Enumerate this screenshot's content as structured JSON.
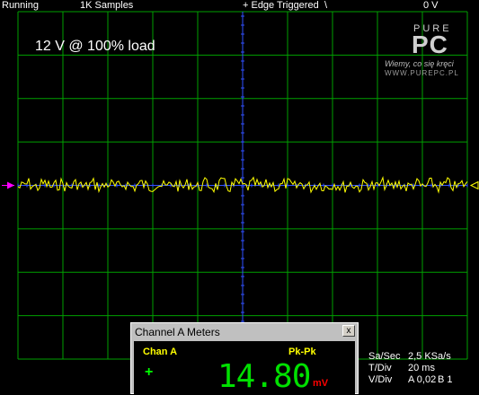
{
  "status": {
    "state": "Running",
    "samples": "1K Samples",
    "trigger": "+ Edge Triggered",
    "trigger_symbol": "\\",
    "trigger_level": "0 V"
  },
  "annotation": "12 V @ 100% load",
  "logo": {
    "pure": "PURE",
    "pc": "PC",
    "tagline": "Wiemy, co się kręci",
    "url": "WWW.PUREPC.PL"
  },
  "meters": {
    "title": "Channel A Meters",
    "close": "x",
    "channel": "Chan A",
    "mode": "Pk-Pk",
    "sign": "+",
    "value": "14.80",
    "unit": "mV"
  },
  "info": {
    "sa_label": "Sa/Sec",
    "sa_value": "2,5 KSa/s",
    "t_label": "T/Div",
    "t_value": "20 ms",
    "v_label": "V/Div",
    "v_value": "A 0,02",
    "v_extra": "B 1"
  },
  "colors": {
    "grid": "#00a000",
    "trace": "#ffff00",
    "center_axis": "#3050ff",
    "ground_marker": "#ff00ff"
  }
}
